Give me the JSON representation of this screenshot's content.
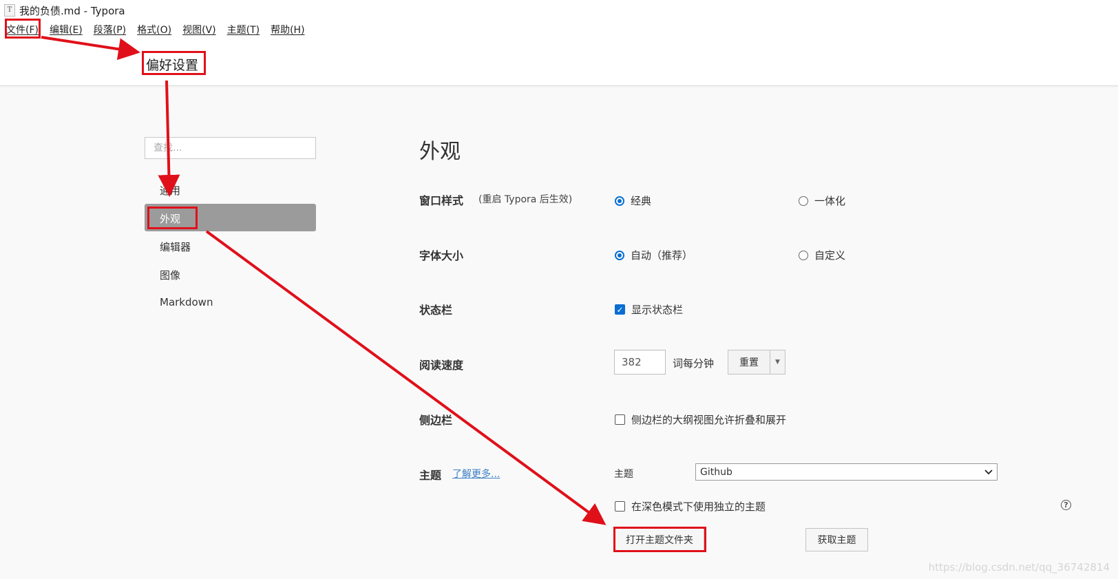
{
  "window": {
    "app_icon": "typora-icon",
    "title": "我的负债.md - Typora"
  },
  "menubar": [
    "文件(F)",
    "编辑(E)",
    "段落(P)",
    "格式(O)",
    "视图(V)",
    "主题(T)",
    "帮助(H)"
  ],
  "annotation": {
    "pref_label": "偏好设置"
  },
  "sidebar": {
    "search_placeholder": "查找...",
    "items": [
      "通用",
      "外观",
      "编辑器",
      "图像",
      "Markdown"
    ],
    "active": "外观"
  },
  "main": {
    "title": "外观",
    "window_style": {
      "label": "窗口样式",
      "note": "(重启 Typora 后生效)",
      "options": [
        "经典",
        "一体化"
      ],
      "selected": "经典"
    },
    "font_size": {
      "label": "字体大小",
      "options": [
        "自动（推荐）",
        "自定义"
      ],
      "selected": "自动（推荐）"
    },
    "status_bar": {
      "label": "状态栏",
      "checkbox": "显示状态栏",
      "checked": true
    },
    "reading_speed": {
      "label": "阅读速度",
      "value": "382",
      "unit": "词每分钟",
      "reset": "重置"
    },
    "sidebar": {
      "label": "侧边栏",
      "checkbox": "侧边栏的大纲视图允许折叠和展开",
      "checked": false
    },
    "theme": {
      "label": "主题",
      "link": "了解更多...",
      "sub_label": "主题",
      "selected": "Github",
      "dark_checkbox": "在深色模式下使用独立的主题",
      "dark_checked": false,
      "open_folder": "打开主题文件夹",
      "get_themes": "获取主题"
    }
  },
  "watermark": "https://blog.csdn.net/qq_36742814",
  "colors": {
    "annotation_red": "#e0101a",
    "accent_blue": "#0a6ed1",
    "active_nav": "#9b9b9b"
  }
}
